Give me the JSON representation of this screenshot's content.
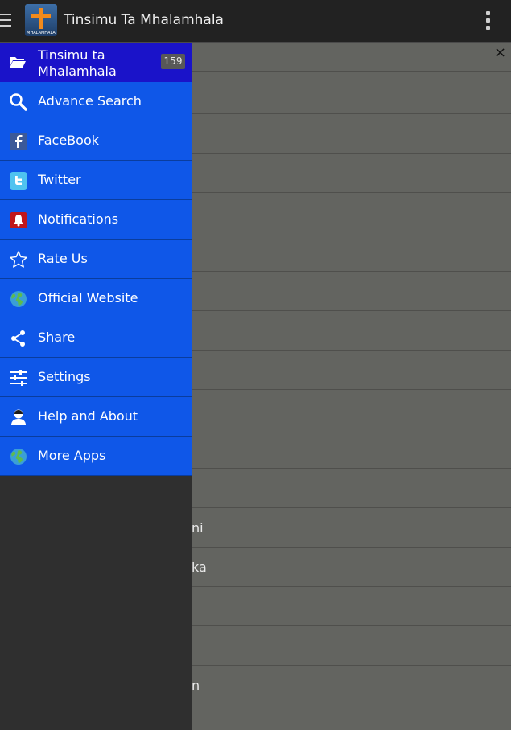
{
  "appbar": {
    "title": "Tinsimu Ta Mhalamhala",
    "logo_text": "MHALAMHALA"
  },
  "drawer": {
    "header": {
      "title": "Tinsimu ta Mhalamhala",
      "count": "159",
      "icon": "folder-icon"
    },
    "items": [
      {
        "label": "Advance Search",
        "icon": "search-icon"
      },
      {
        "label": "FaceBook",
        "icon": "facebook-icon"
      },
      {
        "label": "Twitter",
        "icon": "twitter-icon"
      },
      {
        "label": "Notifications",
        "icon": "bell-icon"
      },
      {
        "label": "Rate Us",
        "icon": "star-icon"
      },
      {
        "label": "Official Website",
        "icon": "globe-icon"
      },
      {
        "label": "Share",
        "icon": "share-icon"
      },
      {
        "label": "Settings",
        "icon": "sliders-icon"
      },
      {
        "label": "Help and About",
        "icon": "person-icon"
      },
      {
        "label": "More Apps",
        "icon": "globe-icon"
      }
    ]
  },
  "content": {
    "close_label": "×",
    "row_fragments": [
      "ni",
      "ka",
      "n"
    ]
  },
  "colors": {
    "appbar": "#222222",
    "drawer_header": "#1a13c9",
    "menu_item": "#0f57e8",
    "content_bg": "#636460"
  }
}
